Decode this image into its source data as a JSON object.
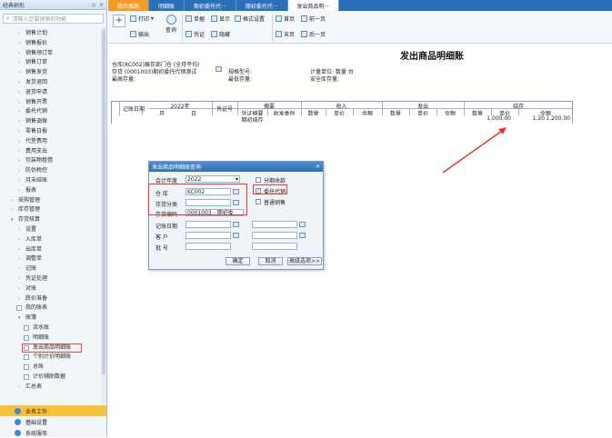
{
  "left_panel": {
    "title": "经典树形",
    "search_placeholder": "请输入您要搜索的功能",
    "tree": [
      {
        "label": "销售计划",
        "indent": 2,
        "type": "arrow"
      },
      {
        "label": "销售报价",
        "indent": 2,
        "type": "arrow"
      },
      {
        "label": "销售预订单",
        "indent": 2,
        "type": "arrow"
      },
      {
        "label": "销售订单",
        "indent": 2,
        "type": "arrow"
      },
      {
        "label": "销售发货",
        "indent": 2,
        "type": "arrow"
      },
      {
        "label": "发货退回",
        "indent": 2,
        "type": "arrow"
      },
      {
        "label": "退货申请",
        "indent": 2,
        "type": "arrow"
      },
      {
        "label": "销售开票",
        "indent": 2,
        "type": "arrow"
      },
      {
        "label": "委托代销",
        "indent": 2,
        "type": "arrow"
      },
      {
        "label": "销售调拨",
        "indent": 2,
        "type": "arrow"
      },
      {
        "label": "零售日报",
        "indent": 2,
        "type": "arrow"
      },
      {
        "label": "代垫费用",
        "indent": 2,
        "type": "arrow"
      },
      {
        "label": "费用支出",
        "indent": 2,
        "type": "arrow"
      },
      {
        "label": "包装物租借",
        "indent": 2,
        "type": "arrow"
      },
      {
        "label": "防伪税控",
        "indent": 2,
        "type": "arrow"
      },
      {
        "label": "月末结账",
        "indent": 2,
        "type": "arrow"
      },
      {
        "label": "报表",
        "indent": 2,
        "type": "arrow"
      },
      {
        "label": "采购管理",
        "indent": 1,
        "type": "arrow"
      },
      {
        "label": "库存管理",
        "indent": 1,
        "type": "arrow"
      },
      {
        "label": "存货核算",
        "indent": 1,
        "type": "open"
      },
      {
        "label": "设置",
        "indent": 2,
        "type": "arrow"
      },
      {
        "label": "入库单",
        "indent": 2,
        "type": "arrow"
      },
      {
        "label": "出库单",
        "indent": 2,
        "type": "arrow"
      },
      {
        "label": "调整单",
        "indent": 2,
        "type": "arrow"
      },
      {
        "label": "记账",
        "indent": 2,
        "type": "arrow"
      },
      {
        "label": "凭证处理",
        "indent": 2,
        "type": "arrow"
      },
      {
        "label": "对账",
        "indent": 2,
        "type": "arrow"
      },
      {
        "label": "跌价准备",
        "indent": 2,
        "type": "arrow"
      },
      {
        "label": "我的账表",
        "indent": 2,
        "type": "doc"
      },
      {
        "label": "账簿",
        "indent": 2,
        "type": "open"
      },
      {
        "label": "流水账",
        "indent": 3,
        "type": "doc"
      },
      {
        "label": "明细账",
        "indent": 3,
        "type": "doc"
      },
      {
        "label": "发出商品明细账",
        "indent": 3,
        "type": "doc",
        "selected": true
      },
      {
        "label": "个别计价明细账",
        "indent": 3,
        "type": "doc"
      },
      {
        "label": "总账",
        "indent": 3,
        "type": "doc"
      },
      {
        "label": "计价辅助数据",
        "indent": 3,
        "type": "doc"
      },
      {
        "label": "汇总表",
        "indent": 2,
        "type": "arrow"
      }
    ],
    "bottom": [
      {
        "label": "业务工作",
        "active": true
      },
      {
        "label": "基础设置",
        "active": false
      },
      {
        "label": "系统服务",
        "active": false
      }
    ]
  },
  "tabs": [
    {
      "label": "我的桌面",
      "style": "home"
    },
    {
      "label": "明细账",
      "style": ""
    },
    {
      "label": "期初委托代···",
      "style": ""
    },
    {
      "label": "期初委托代···",
      "style": ""
    },
    {
      "label": "发出商品明···",
      "style": "active"
    }
  ],
  "toolbar": {
    "print": "打印",
    "export": "输出",
    "query": "查询",
    "single": "单据",
    "voucher": "凭证",
    "show": "显示",
    "hide": "隐藏",
    "format": "格式设置",
    "first": "首页",
    "last": "末页",
    "prev": "前一页",
    "next": "后一页"
  },
  "report": {
    "title": "发出商品明细账",
    "warehouse": "仓库(KC002)展存部门仓 (全月平均)",
    "inventory": "存货 (0001003)期初委托代销测试",
    "max_stock": "最高存量:",
    "spec": "规格型号:",
    "min_stock": "最低存量:",
    "unit": "计量单位: 数量 台",
    "safe_stock": "安全库存量:",
    "headers": {
      "date": "记账日期",
      "year": "2022年",
      "month": "月",
      "day": "日",
      "voucher_no": "凭证号",
      "summary": "摘要",
      "voucher_summary": "凭证摘要",
      "send_type": "收发类别",
      "income": "收入",
      "issue": "发出",
      "balance": "结存",
      "qty": "数量",
      "price": "单价",
      "amount": "金额"
    },
    "row": {
      "summary": "期初结存",
      "qty": "1,000.00",
      "price": "1.20",
      "amount": "1,200.00"
    }
  },
  "dialog": {
    "title": "发出商品明细账查询",
    "year_label": "会计年度",
    "year_value": "2022",
    "warehouse_label": "仓  库",
    "warehouse_value": "KC002",
    "category_label": "存货分类",
    "category_value": "",
    "code_label": "存货编码",
    "code_value": "0001003 - 期初委",
    "date_label": "记账日期",
    "customer_label": "客  户",
    "batch_label": "批  号",
    "by_batch": "分期收款",
    "consign": "委托代销",
    "normal": "普通销售",
    "ok": "确定",
    "cancel": "取消",
    "advanced": "高级选项>>"
  },
  "colors": {
    "accent": "#2a6fb9",
    "home_tab": "#f39b24",
    "highlight": "#e13b2e",
    "active_bottom": "#f5c23a"
  }
}
